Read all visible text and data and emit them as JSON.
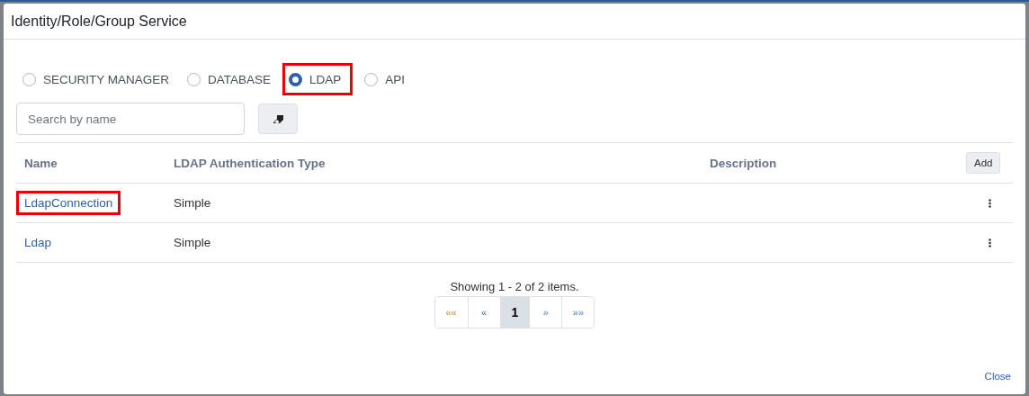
{
  "window": {
    "title": "Identity/Role/Group Service"
  },
  "source_options": [
    {
      "label": "SECURITY MANAGER",
      "selected": false,
      "highlighted": false
    },
    {
      "label": "DATABASE",
      "selected": false,
      "highlighted": false
    },
    {
      "label": "LDAP",
      "selected": true,
      "highlighted": true
    },
    {
      "label": "API",
      "selected": false,
      "highlighted": false
    }
  ],
  "search": {
    "placeholder": "Search by name"
  },
  "table": {
    "columns": [
      "Name",
      "LDAP Authentication Type",
      "Description"
    ],
    "add_button": "Add",
    "rows": [
      {
        "name": "LdapConnection",
        "auth_type": "Simple",
        "highlighted": true
      },
      {
        "name": "Ldap",
        "auth_type": "Simple",
        "highlighted": false
      }
    ]
  },
  "pagination": {
    "summary": "Showing 1 - 2 of 2 items.",
    "pages": [
      {
        "label": "««",
        "kind": "first",
        "selected": false
      },
      {
        "label": "«",
        "kind": "prev",
        "selected": false
      },
      {
        "label": "1",
        "kind": "page",
        "selected": true
      },
      {
        "label": "»",
        "kind": "next",
        "selected": false
      },
      {
        "label": "»»",
        "kind": "last",
        "selected": false
      }
    ]
  },
  "footer": {
    "close": "Close"
  }
}
